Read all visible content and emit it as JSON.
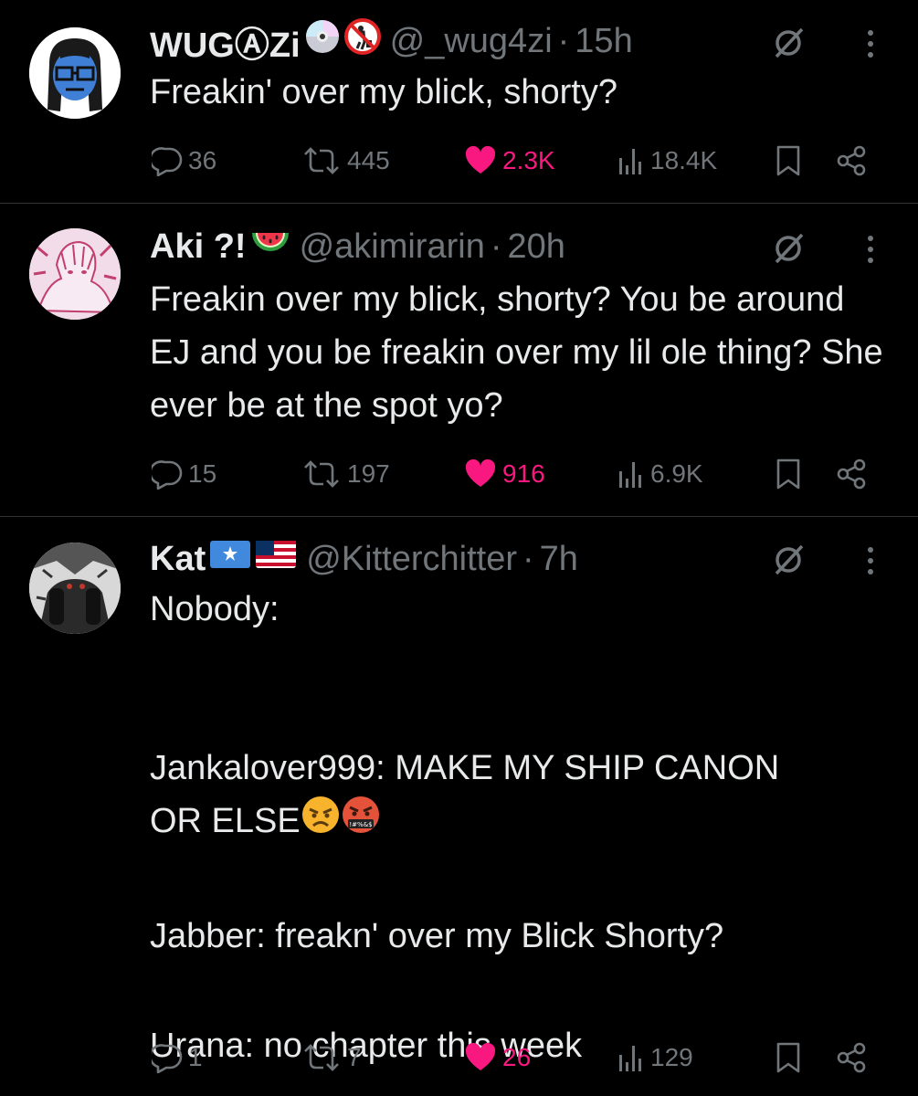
{
  "colors": {
    "background": "#000000",
    "text": "#e7e9ea",
    "muted": "#71767b",
    "like": "#f91880",
    "divider": "#2f3336"
  },
  "tweets": [
    {
      "name": "WUGⒶZi",
      "badges": [
        "cd-disc-emoji",
        "no-littering-emoji"
      ],
      "handle": "@_wug4zi",
      "separator": "·",
      "time": "15h",
      "text": "Freakin' over my blick, shorty?",
      "replies": "36",
      "retweets": "445",
      "likes": "2.3K",
      "views": "18.4K"
    },
    {
      "name": "Aki ?!",
      "badges": [
        "watermelon-emoji"
      ],
      "handle": "@akimirarin",
      "separator": "·",
      "time": "20h",
      "text": "Freakin over my blick, shorty? You be around EJ and you be freakin over my lil ole thing? She ever be at the spot yo?",
      "replies": "15",
      "retweets": "197",
      "likes": "916",
      "views": "6.9K"
    },
    {
      "name": "Kat",
      "badges": [
        "somalia-flag-emoji",
        "usa-flag-emoji"
      ],
      "handle": "@Kitterchitter",
      "separator": "·",
      "time": "7h",
      "text_lines": {
        "l1": "Nobody:",
        "l2": "Jankalover999: MAKE MY SHIP CANON",
        "l3": "OR ELSE",
        "l4": "Jabber: freakn' over my Blick Shorty?",
        "l5": "Urana: no chapter this week"
      },
      "text_emojis": [
        "angry-face-emoji",
        "cursing-face-emoji"
      ],
      "cursing_text": "!#%&$",
      "replies": "1",
      "retweets": "7",
      "likes": "26",
      "views": "129"
    }
  ]
}
